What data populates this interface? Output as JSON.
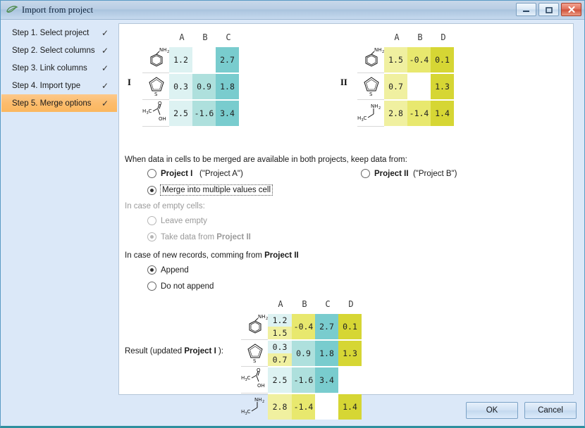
{
  "window": {
    "title": "Import from project",
    "icon": "leaf-icon",
    "buttons": {
      "minimize": "minimize-icon",
      "maximize": "maximize-icon",
      "close": "close-icon"
    }
  },
  "sidebar": {
    "steps": [
      {
        "label": "Step 1. Select project",
        "check": "✓",
        "active": false
      },
      {
        "label": "Step 2. Select columns",
        "check": "✓",
        "active": false
      },
      {
        "label": "Step 3. Link columns",
        "check": "✓",
        "active": false
      },
      {
        "label": "Step 4. Import type",
        "check": "✓",
        "active": false
      },
      {
        "label": "Step 5. Merge options",
        "check": "✓",
        "active": true
      }
    ]
  },
  "colors": {
    "teal_light": "#ddf2f2",
    "teal_mid": "#aee0dd",
    "teal_dark": "#79ccce",
    "yellow_light": "#f0f0a0",
    "yellow_mid": "#e8e86e",
    "yellow_dark": "#d6d634",
    "highlight": "#fbbb63",
    "window_bg": "#dbe8f8"
  },
  "project_one": {
    "badge": "I",
    "columns": [
      "A",
      "B",
      "C"
    ],
    "rows": [
      {
        "molecule": "aniline",
        "values": [
          "1.2",
          "",
          "2.7"
        ]
      },
      {
        "molecule": "thiophene",
        "values": [
          "0.3",
          "0.9",
          "1.8"
        ]
      },
      {
        "molecule": "acetic-acid",
        "values": [
          "2.5",
          "-1.6",
          "3.4"
        ]
      }
    ]
  },
  "project_two": {
    "badge": "II",
    "columns": [
      "A",
      "B",
      "D"
    ],
    "rows": [
      {
        "molecule": "aniline",
        "values": [
          "1.5",
          "-0.4",
          "0.1"
        ]
      },
      {
        "molecule": "thiophene",
        "values": [
          "0.7",
          "",
          "1.3"
        ]
      },
      {
        "molecule": "ethylamine",
        "values": [
          "2.8",
          "-1.4",
          "1.4"
        ]
      }
    ]
  },
  "options": {
    "prompt": "When data in cells to be merged are available in both projects, keep data from:",
    "keep_project_i": {
      "label": "Project I",
      "note": "(\"Project A\")",
      "selected": false
    },
    "keep_project_ii": {
      "label": "Project II",
      "note": "(\"Project B\")",
      "selected": false
    },
    "merge_multi": {
      "label": "Merge into multiple values cell",
      "selected": true
    },
    "empty_header": "In case of empty cells:",
    "leave_empty": {
      "label": "Leave empty",
      "selected": false,
      "disabled": true
    },
    "take_from_ii": {
      "label": "Take data from ",
      "bold": "Project II",
      "selected": true,
      "disabled": true
    },
    "new_records_header": "In case of new records, comming from ",
    "new_records_header_bold": "Project II",
    "append": {
      "label": "Append",
      "selected": true
    },
    "do_not_append": {
      "label": "Do not append",
      "selected": false
    }
  },
  "result": {
    "label_prefix": "Result (updated ",
    "label_bold": "Project I",
    "label_suffix": " ):",
    "columns": [
      "A",
      "B",
      "C",
      "D"
    ],
    "rows": [
      {
        "molecule": "aniline",
        "A": {
          "top": "1.2",
          "bottom": "1.5",
          "split": true
        },
        "B": {
          "value": "-0.4",
          "tone": "yellow_mid"
        },
        "C": {
          "value": "2.7",
          "tone": "teal_dark"
        },
        "D": {
          "value": "0.1",
          "tone": "yellow_dark"
        }
      },
      {
        "molecule": "thiophene",
        "A": {
          "top": "0.3",
          "bottom": "0.7",
          "split": true
        },
        "B": {
          "value": "0.9",
          "tone": "teal_mid"
        },
        "C": {
          "value": "1.8",
          "tone": "teal_dark"
        },
        "D": {
          "value": "1.3",
          "tone": "yellow_dark"
        }
      },
      {
        "molecule": "acetic-acid",
        "A": {
          "value": "2.5",
          "tone": "teal_light",
          "split": false
        },
        "B": {
          "value": "-1.6",
          "tone": "teal_mid"
        },
        "C": {
          "value": "3.4",
          "tone": "teal_dark"
        },
        "D": {
          "value": "",
          "tone": "none"
        }
      },
      {
        "molecule": "ethylamine",
        "A": {
          "value": "2.8",
          "tone": "yellow_light",
          "split": false
        },
        "B": {
          "value": "-1.4",
          "tone": "yellow_mid"
        },
        "C": {
          "value": "",
          "tone": "none"
        },
        "D": {
          "value": "1.4",
          "tone": "yellow_dark"
        }
      }
    ]
  },
  "footer": {
    "ok": "OK",
    "cancel": "Cancel"
  }
}
